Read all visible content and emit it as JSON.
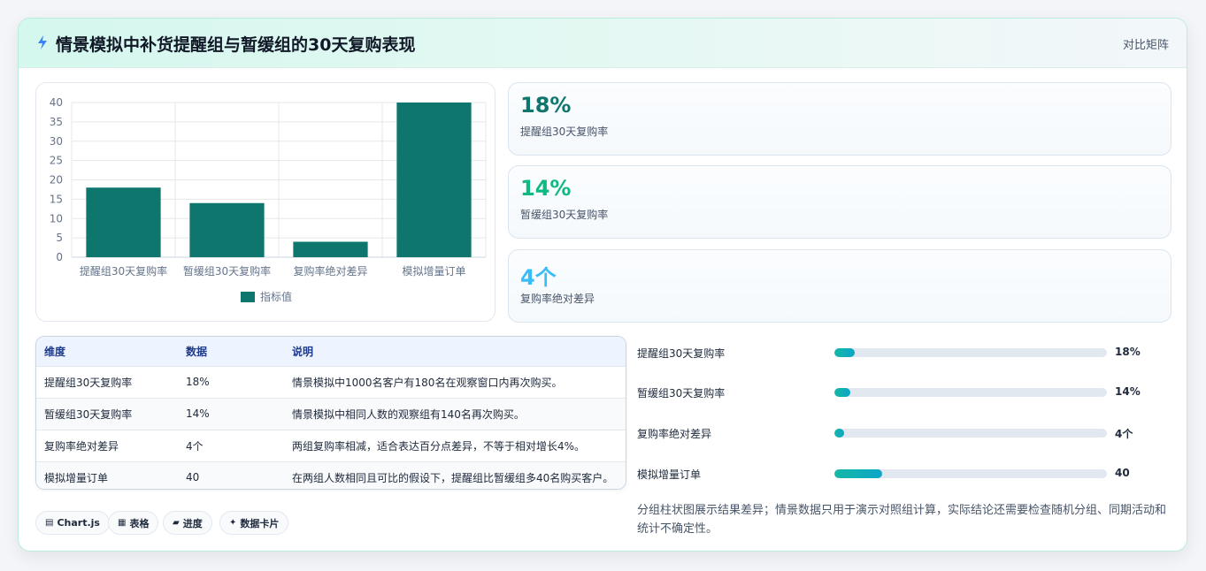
{
  "header": {
    "title": "情景模拟中补货提醒组与暂缓组的30天复购表现",
    "matrix_label": "对比矩阵"
  },
  "chart_data": {
    "type": "bar",
    "categories": [
      "提醒组30天复购率",
      "暂缓组30天复购率",
      "复购率绝对差异",
      "模拟增量订单"
    ],
    "series": [
      {
        "name": "指标值",
        "values": [
          18,
          14,
          4,
          40
        ]
      }
    ],
    "ylim": [
      0,
      40
    ],
    "yticks": [
      0,
      5,
      10,
      15,
      20,
      25,
      30,
      35,
      40
    ],
    "grid": true,
    "legend": "bottom",
    "color": "#0f766e"
  },
  "stats": [
    {
      "value": "18%",
      "label": "提醒组30天复购率",
      "color": "#0f766e"
    },
    {
      "value": "14%",
      "label": "暂缓组30天复购率",
      "color": "#10b981"
    },
    {
      "value": "4个",
      "label": "复购率绝对差异",
      "color": "#38bdf8"
    }
  ],
  "table": {
    "headers": [
      "维度",
      "数据",
      "说明"
    ],
    "rows": [
      [
        "提醒组30天复购率",
        "18%",
        "情景模拟中1000名客户有180名在观察窗口内再次购买。"
      ],
      [
        "暂缓组30天复购率",
        "14%",
        "情景模拟中相同人数的观察组有140名再次购买。"
      ],
      [
        "复购率绝对差异",
        "4个",
        "两组复购率相减，适合表达百分点差异，不等于相对增长4%。"
      ],
      [
        "模拟增量订单",
        "40",
        "在两组人数相同且可比的假设下，提醒组比暂缓组多40名购买客户。"
      ]
    ]
  },
  "progress": [
    {
      "label": "提醒组30天复购率",
      "value_text": "18%",
      "fraction": 0.075
    },
    {
      "label": "暂缓组30天复购率",
      "value_text": "14%",
      "fraction": 0.06
    },
    {
      "label": "复购率绝对差异",
      "value_text": "4个",
      "fraction": 0.035
    },
    {
      "label": "模拟增量订单",
      "value_text": "40",
      "fraction": 0.175
    }
  ],
  "chips": [
    {
      "icon": "▤",
      "label": "Chart.js"
    },
    {
      "icon": "▦",
      "label": "表格"
    },
    {
      "icon": "▰",
      "label": "进度"
    },
    {
      "icon": "✦",
      "label": "数据卡片"
    }
  ],
  "note": "分组柱状图展示结果差异；情景数据只用于演示对照组计算，实际结论还需要检查随机分组、同期活动和统计不确定性。"
}
